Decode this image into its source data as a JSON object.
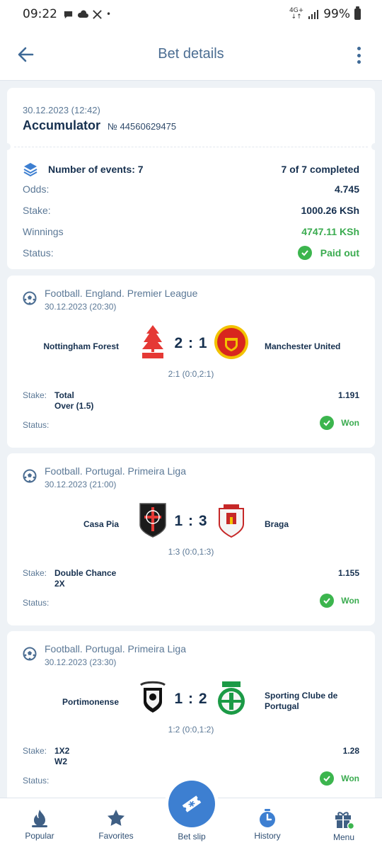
{
  "status_bar": {
    "time": "09:22",
    "network": "4G+",
    "battery": "99%"
  },
  "header": {
    "title": "Bet details",
    "back_icon": "arrow-left-icon",
    "more_icon": "more-vertical-icon"
  },
  "summary": {
    "date": "30.12.2023 (12:42)",
    "type": "Accumulator",
    "number": "№ 44560629475",
    "events_label": "Number of events: 7",
    "completed": "7 of 7 completed",
    "odds_label": "Odds:",
    "odds_value": "4.745",
    "stake_label": "Stake:",
    "stake_value": "1000.26 KSh",
    "winnings_label": "Winnings",
    "winnings_value": "4747.11 KSh",
    "status_label": "Status:",
    "status_value": "Paid out",
    "colors": {
      "green": "#3cb54e",
      "primary": "#3d7fd1"
    }
  },
  "events": [
    {
      "league": "Football. England. Premier League",
      "date": "30.12.2023 (20:30)",
      "home": "Nottingham Forest",
      "away": "Manchester United",
      "score": "2 : 1",
      "score_detail": "2:1 (0:0,2:1)",
      "stake_label": "Stake:",
      "stake": "Total\nOver (1.5)",
      "odd": "1.191",
      "status_label": "Status:",
      "status": "Won"
    },
    {
      "league": "Football. Portugal. Primeira Liga",
      "date": "30.12.2023 (21:00)",
      "home": "Casa Pia",
      "away": "Braga",
      "score": "1 : 3",
      "score_detail": "1:3 (0:0,1:3)",
      "stake_label": "Stake:",
      "stake": "Double Chance\n2X",
      "odd": "1.155",
      "status_label": "Status:",
      "status": "Won"
    },
    {
      "league": "Football. Portugal. Primeira Liga",
      "date": "30.12.2023 (23:30)",
      "home": "Portimonense",
      "away": "Sporting Clube de Portugal",
      "score": "1 : 2",
      "score_detail": "1:2 (0:0,1:2)",
      "stake_label": "Stake:",
      "stake": "1X2\nW2",
      "odd": "1.28",
      "status_label": "Status:",
      "status": "Won"
    }
  ],
  "bottom_nav": {
    "popular": "Popular",
    "favorites": "Favorites",
    "bet_slip": "Bet slip",
    "history": "History",
    "menu": "Menu"
  }
}
